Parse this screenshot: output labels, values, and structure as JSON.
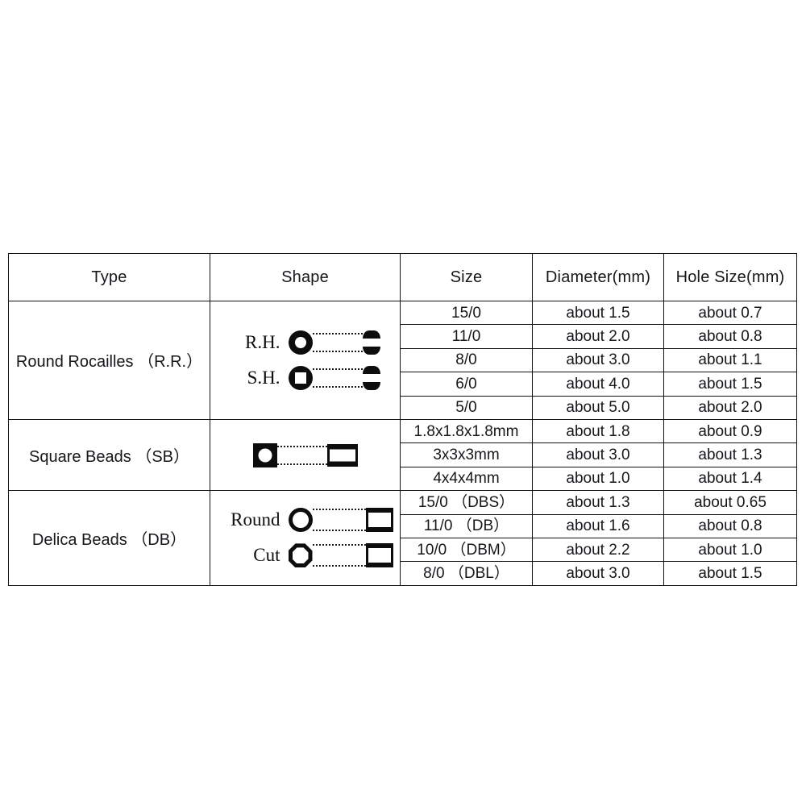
{
  "table": {
    "headers": {
      "type": "Type",
      "shape": "Shape",
      "size": "Size",
      "diameter": "Diameter(mm)",
      "hole": "Hole Size(mm)"
    },
    "groups": [
      {
        "type_label": "Round Rocailles （R.R.）",
        "shape_labels": [
          "R.H.",
          "S.H."
        ],
        "shape_icons": [
          "round-hole-bead-icon",
          "square-hole-bead-icon"
        ],
        "rows": [
          {
            "size": "15/0",
            "diameter": "about 1.5",
            "hole": "about 0.7"
          },
          {
            "size": "11/0",
            "diameter": "about 2.0",
            "hole": "about 0.8"
          },
          {
            "size": "8/0",
            "diameter": "about 3.0",
            "hole": "about 1.1"
          },
          {
            "size": "6/0",
            "diameter": "about 4.0",
            "hole": "about 1.5"
          },
          {
            "size": "5/0",
            "diameter": "about 5.0",
            "hole": "about 2.0"
          }
        ]
      },
      {
        "type_label": "Square Beads （SB）",
        "shape_labels": [
          ""
        ],
        "shape_icons": [
          "square-bead-icon"
        ],
        "rows": [
          {
            "size": "1.8x1.8x1.8mm",
            "diameter": "about 1.8",
            "hole": "about 0.9"
          },
          {
            "size": "3x3x3mm",
            "diameter": "about 3.0",
            "hole": "about 1.3"
          },
          {
            "size": "4x4x4mm",
            "diameter": "about 1.0",
            "hole": "about 1.4"
          }
        ]
      },
      {
        "type_label": "Delica Beads （DB）",
        "shape_labels": [
          "Round",
          "Cut"
        ],
        "shape_icons": [
          "delica-round-bead-icon",
          "delica-cut-bead-icon"
        ],
        "rows": [
          {
            "size": "15/0 （DBS）",
            "diameter": "about 1.3",
            "hole": "about 0.65"
          },
          {
            "size": "11/0 （DB）",
            "diameter": "about 1.6",
            "hole": "about 0.8"
          },
          {
            "size": "10/0 （DBM）",
            "diameter": "about 2.2",
            "hole": "about 1.0"
          },
          {
            "size": "8/0 （DBL）",
            "diameter": "about 3.0",
            "hole": "about 1.5"
          }
        ]
      }
    ]
  },
  "colors": {
    "border": "#111111",
    "text": "#16171b",
    "glyph": "#0d0d0d",
    "background": "#ffffff"
  }
}
